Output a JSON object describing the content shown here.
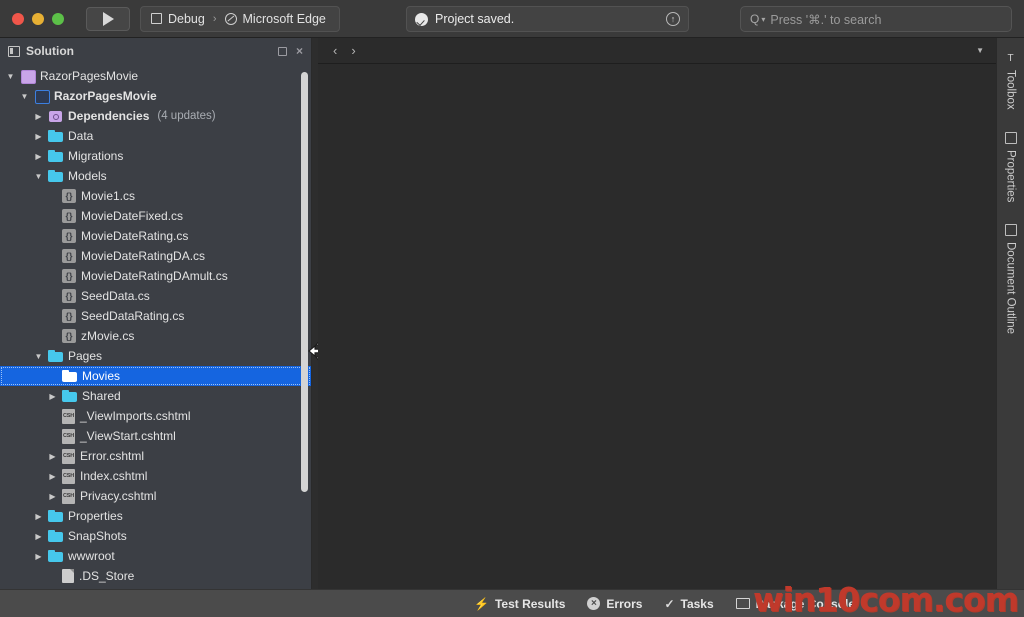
{
  "toolbar": {
    "run_button_label": "run",
    "config": {
      "scheme": "Debug",
      "separator": "›",
      "target": "Microsoft Edge"
    },
    "status": {
      "text": "Project saved.",
      "info_icon": "↑"
    },
    "search": {
      "placeholder": "Press '⌘.' to search",
      "icon": "Q"
    }
  },
  "sidebar": {
    "title": "Solution",
    "actions": {
      "pin": "pin-icon",
      "close": "×"
    },
    "tree": [
      {
        "label": "RazorPagesMovie",
        "icon": "solution",
        "arrow": "▼",
        "indent": 0,
        "bold": false
      },
      {
        "label": "RazorPagesMovie",
        "icon": "project",
        "arrow": "▼",
        "indent": 1,
        "bold": true
      },
      {
        "label": "Dependencies",
        "suffix": "(4 updates)",
        "icon": "dependencies",
        "arrow": "▶",
        "indent": 2,
        "bold": true
      },
      {
        "label": "Data",
        "icon": "folder",
        "arrow": "▶",
        "indent": 2,
        "bold": false
      },
      {
        "label": "Migrations",
        "icon": "folder",
        "arrow": "▶",
        "indent": 2,
        "bold": false
      },
      {
        "label": "Models",
        "icon": "folder",
        "arrow": "▼",
        "indent": 2,
        "bold": false
      },
      {
        "label": "Movie1.cs",
        "icon": "cs",
        "arrow": "",
        "indent": 3,
        "bold": false
      },
      {
        "label": "MovieDateFixed.cs",
        "icon": "cs",
        "arrow": "",
        "indent": 3,
        "bold": false
      },
      {
        "label": "MovieDateRating.cs",
        "icon": "cs",
        "arrow": "",
        "indent": 3,
        "bold": false
      },
      {
        "label": "MovieDateRatingDA.cs",
        "icon": "cs",
        "arrow": "",
        "indent": 3,
        "bold": false
      },
      {
        "label": "MovieDateRatingDAmult.cs",
        "icon": "cs",
        "arrow": "",
        "indent": 3,
        "bold": false
      },
      {
        "label": "SeedData.cs",
        "icon": "cs",
        "arrow": "",
        "indent": 3,
        "bold": false
      },
      {
        "label": "SeedDataRating.cs",
        "icon": "cs",
        "arrow": "",
        "indent": 3,
        "bold": false
      },
      {
        "label": "zMovie.cs",
        "icon": "cs",
        "arrow": "",
        "indent": 3,
        "bold": false
      },
      {
        "label": "Pages",
        "icon": "folder",
        "arrow": "▼",
        "indent": 2,
        "bold": false
      },
      {
        "label": "Movies",
        "icon": "folder",
        "arrow": "",
        "indent": 3,
        "bold": false,
        "selected": true
      },
      {
        "label": "Shared",
        "icon": "folder",
        "arrow": "▶",
        "indent": 3,
        "bold": false
      },
      {
        "label": "_ViewImports.cshtml",
        "icon": "cshtml",
        "arrow": "",
        "indent": 3,
        "bold": false
      },
      {
        "label": "_ViewStart.cshtml",
        "icon": "cshtml",
        "arrow": "",
        "indent": 3,
        "bold": false
      },
      {
        "label": "Error.cshtml",
        "icon": "cshtml",
        "arrow": "▶",
        "indent": 3,
        "bold": false
      },
      {
        "label": "Index.cshtml",
        "icon": "cshtml",
        "arrow": "▶",
        "indent": 3,
        "bold": false
      },
      {
        "label": "Privacy.cshtml",
        "icon": "cshtml",
        "arrow": "▶",
        "indent": 3,
        "bold": false
      },
      {
        "label": "Properties",
        "icon": "folder",
        "arrow": "▶",
        "indent": 2,
        "bold": false
      },
      {
        "label": "SnapShots",
        "icon": "folder",
        "arrow": "▶",
        "indent": 2,
        "bold": false
      },
      {
        "label": "wwwroot",
        "icon": "folder",
        "arrow": "▶",
        "indent": 2,
        "bold": false
      },
      {
        "label": ".DS_Store",
        "icon": "plainfile",
        "arrow": "",
        "indent": 3,
        "bold": false
      }
    ]
  },
  "editor": {
    "back_chevron": "‹",
    "forward_chevron": "›",
    "dropdown_caret": "▼"
  },
  "rightbar": {
    "tabs": [
      {
        "label": "Toolbox",
        "icon": "T"
      },
      {
        "label": "Properties",
        "icon": "grid"
      },
      {
        "label": "Document Outline",
        "icon": "outline"
      }
    ]
  },
  "bottombar": {
    "items": [
      {
        "label": "Test Results",
        "icon": "⚡"
      },
      {
        "label": "Errors",
        "icon": "×"
      },
      {
        "label": "Tasks",
        "icon": "✓"
      },
      {
        "label": "Package Console",
        "icon": "console"
      }
    ]
  },
  "watermark": {
    "prefix": "win",
    "mid": "10com",
    "suffix": ".com",
    "full": "win10com.com"
  },
  "colors": {
    "accent_selection": "#1565e0",
    "folder": "#46c8ec",
    "dependency": "#c9a5e8",
    "editor_bg": "#2b2b2b",
    "sidebar_bg": "#3c3f45",
    "toolbar_bg": "#3a3a3a",
    "bottombar_bg": "#4b4b4b"
  }
}
